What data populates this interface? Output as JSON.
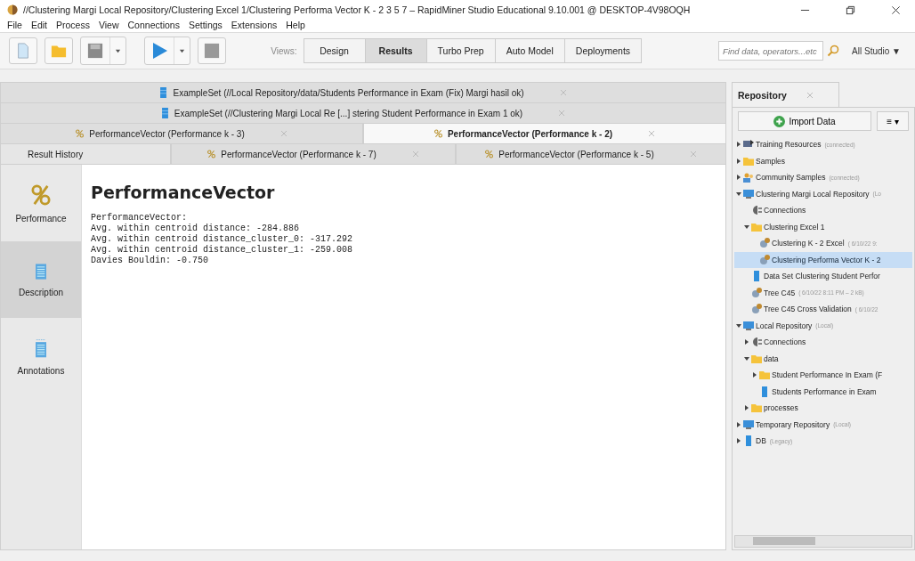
{
  "window": {
    "title": "//Clustering Margi  Local Repository/Clustering Excel 1/Clustering Performa Vector K - 2 3 5 7  – RapidMiner Studio Educational 9.10.001 @ DESKTOP-4V98OQH"
  },
  "menu": [
    "File",
    "Edit",
    "Process",
    "View",
    "Connections",
    "Settings",
    "Extensions",
    "Help"
  ],
  "toolbar": {
    "views_label": "Views:",
    "views": [
      {
        "label": "Design",
        "selected": false
      },
      {
        "label": "Results",
        "selected": true
      },
      {
        "label": "Turbo Prep",
        "selected": false
      },
      {
        "label": "Auto Model",
        "selected": false
      },
      {
        "label": "Deployments",
        "selected": false
      }
    ],
    "search": {
      "placeholder": "Find data, operators...etc"
    },
    "scope": "All Studio ▼"
  },
  "tab_rows": [
    [
      {
        "label": "ExampleSet (//Local Repository/data/Students Performance in Exam (Fix) Margi hasil ok)",
        "kind": "data",
        "selected": false
      }
    ],
    [
      {
        "label": "ExampleSet (//Clustering Margi  Local Re [...] stering Student Performance in Exam 1 ok)",
        "kind": "data",
        "selected": false
      }
    ],
    [
      {
        "label": "PerformanceVector (Performance k - 3)",
        "kind": "perf",
        "selected": false
      },
      {
        "label": "PerformanceVector (Performance k - 2)",
        "kind": "perf",
        "selected": true
      }
    ],
    [
      {
        "label": "Result History",
        "kind": "history",
        "selected": false
      },
      {
        "label": "PerformanceVector (Performance k - 7)",
        "kind": "perf",
        "selected": false
      },
      {
        "label": "PerformanceVector (Performance k - 5)",
        "kind": "perf",
        "selected": false
      }
    ]
  ],
  "side_tabs": [
    {
      "label": "Performance",
      "kind": "percent",
      "selected": false
    },
    {
      "label": "Description",
      "kind": "doc",
      "selected": true
    },
    {
      "label": "Annotations",
      "kind": "notes",
      "selected": false
    }
  ],
  "result": {
    "heading": "PerformanceVector",
    "lines": [
      "PerformanceVector:",
      "Avg. within centroid distance: -284.886",
      "Avg. within centroid distance_cluster_0: -317.292",
      "Avg. within centroid distance_cluster_1: -259.008",
      "Davies Bouldin: -0.750"
    ]
  },
  "repository": {
    "tab": "Repository",
    "import_button": "Import Data",
    "menu_button": "≡ ▾",
    "tree": [
      {
        "label": "Training Resources",
        "meta": "(connected)",
        "kind": "training",
        "expanded": false,
        "selected": false
      },
      {
        "label": "Samples",
        "kind": "folder",
        "expanded": false,
        "selected": false
      },
      {
        "label": "Community Samples",
        "meta": "(connected)",
        "kind": "people",
        "expanded": false,
        "selected": false
      },
      {
        "label": "Clustering Margi Local Repository",
        "meta": "(Lo",
        "kind": "repo",
        "expanded": true,
        "selected": false,
        "children": [
          {
            "label": "Connections",
            "kind": "conn",
            "selected": false
          },
          {
            "label": "Clustering Excel 1",
            "kind": "folder",
            "expanded": true,
            "selected": false,
            "children": [
              {
                "label": "Clustering K - 2 Excel",
                "meta": "( 6/10/22 9:",
                "kind": "process",
                "selected": false
              },
              {
                "label": "Clustering Performa Vector K - 2",
                "kind": "process",
                "selected": true
              }
            ]
          },
          {
            "label": "Data Set Clustering Student Perfor",
            "kind": "data",
            "selected": false
          },
          {
            "label": "Tree C45",
            "meta": "( 6/10/22 8:11 PM – 2 kB)",
            "kind": "process",
            "selected": false
          },
          {
            "label": "Tree C45 Cross Validation",
            "meta": "( 6/10/22",
            "kind": "process",
            "selected": false
          }
        ]
      },
      {
        "label": "Local Repository",
        "meta": "(Local)",
        "kind": "repo",
        "expanded": true,
        "selected": false,
        "children": [
          {
            "label": "Connections",
            "kind": "conn",
            "expanded": false,
            "selected": false
          },
          {
            "label": "data",
            "kind": "folder",
            "expanded": true,
            "selected": false,
            "children": [
              {
                "label": "Student Performance In Exam (F",
                "kind": "folder",
                "expanded": false,
                "selected": false
              },
              {
                "label": "Students Performance in Exam",
                "kind": "data",
                "selected": false
              }
            ]
          },
          {
            "label": "processes",
            "kind": "folder",
            "expanded": false,
            "selected": false
          }
        ]
      },
      {
        "label": "Temporary Repository",
        "meta": "(Local)",
        "kind": "repo",
        "expanded": false,
        "selected": false
      },
      {
        "label": "DB",
        "meta": "(Legacy)",
        "kind": "data",
        "expanded": false,
        "selected": false
      }
    ]
  }
}
